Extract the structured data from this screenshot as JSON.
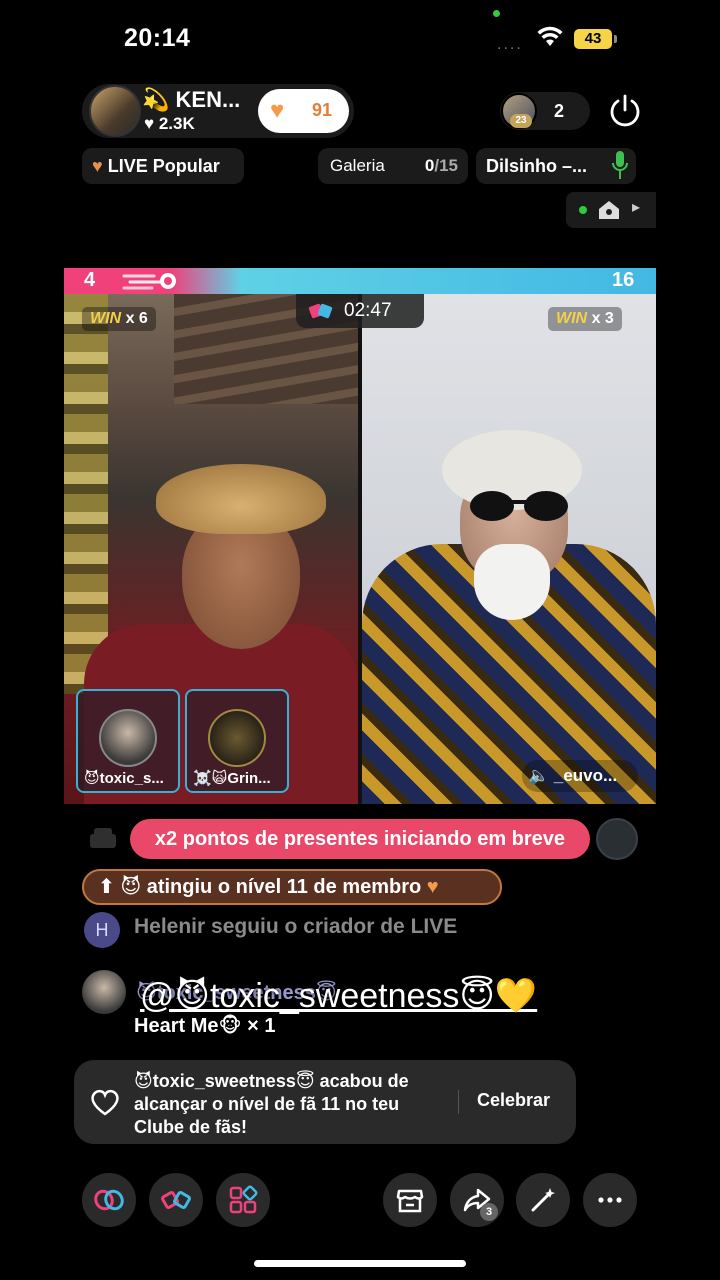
{
  "status": {
    "time": "20:14",
    "signal": "....",
    "battery": "43"
  },
  "host": {
    "name": "💫 KEN...",
    "likes": "♥ 2.3K",
    "like_count": "91"
  },
  "viewers": {
    "badge": "23",
    "count": "2"
  },
  "tags": {
    "popular_label": "LIVE Popular",
    "gallery_label": "Galeria",
    "gallery_current": "0",
    "gallery_total": "/15",
    "music": "Dilsinho –..."
  },
  "battle": {
    "score_left": "4",
    "score_right": "16",
    "timer": "02:47",
    "win_word": "WIN",
    "win_left": "x 6",
    "win_right": "x 3",
    "gifter_1": "😈toxic_s...",
    "gifter_2": "☠️🙀Grin...",
    "rival_name": "🔈 _euvo..."
  },
  "chat": {
    "points_banner": "x2 pontos de presentes iniciando em breve",
    "level_banner": "⬆ 😈 atingiu o nível 11 de membro",
    "follower_initial": "H",
    "follow_message": "Helenir seguiu o criador de LIVE",
    "gift_line1": "😈toxic_sweetness😇",
    "gift_line2": "Heart Me🐵 × 1",
    "mention": "@😈toxic_sweetness😇💛"
  },
  "fan_card": {
    "text": "😈toxic_sweetness😇 acabou de alcançar o nível de fã 11 no teu Clube de fãs!",
    "cta": "Celebrar"
  },
  "bottom_bar": {
    "share_count": "3"
  },
  "colors": {
    "accent_pink": "#ea4868",
    "accent_orange": "#f39a4b",
    "win_gold": "#f3d04a",
    "battle_blue": "#42b8e3"
  }
}
